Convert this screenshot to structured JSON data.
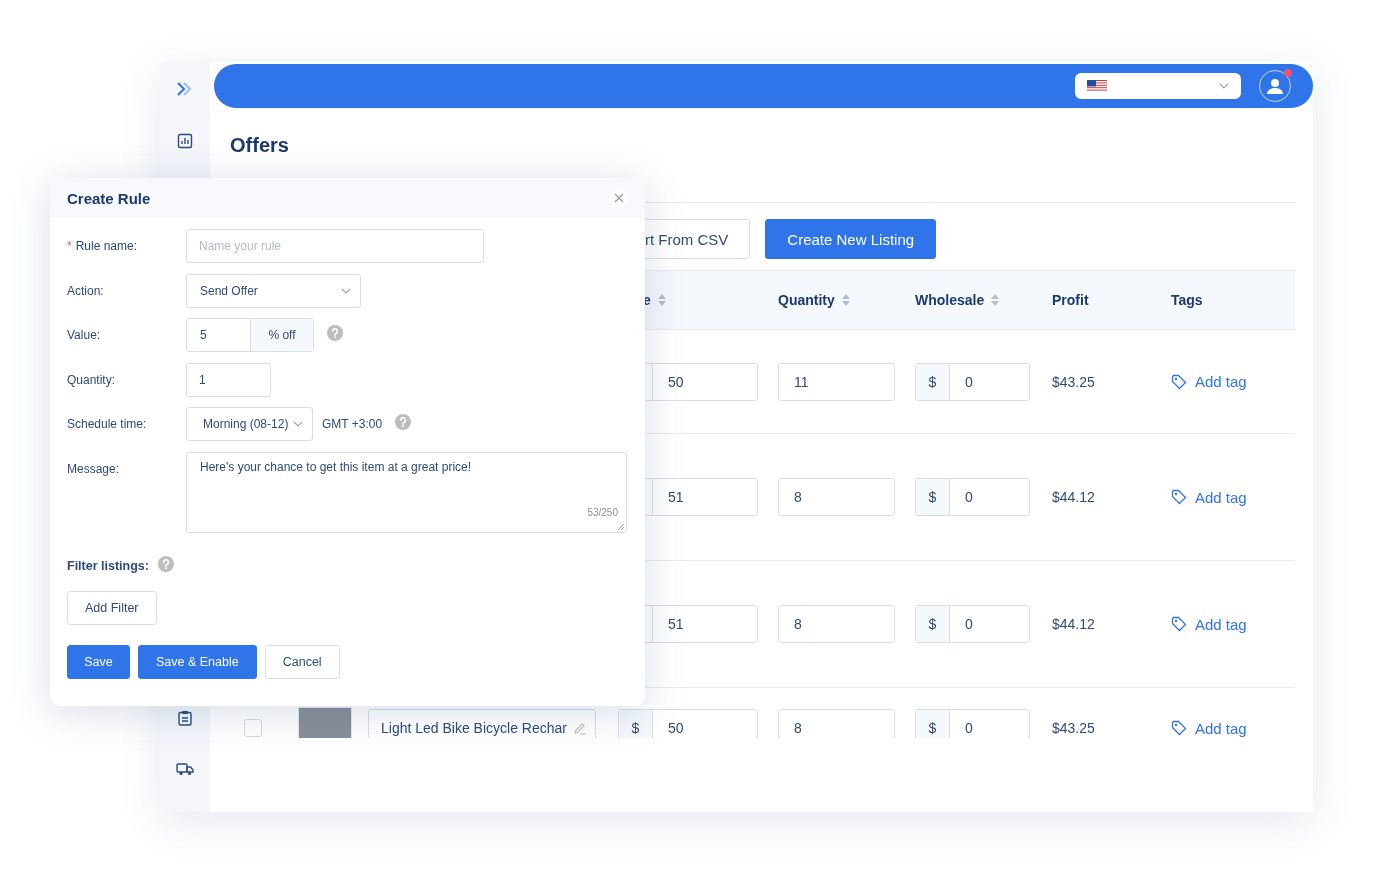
{
  "page": {
    "title": "Offers"
  },
  "toolbar": {
    "buttons": [
      {
        "label": "rt From CSV",
        "kind": "outline"
      },
      {
        "label": "Create New Listing",
        "kind": "primary"
      }
    ]
  },
  "table": {
    "columns": [
      {
        "label": "e",
        "sortable": true
      },
      {
        "label": "Quantity",
        "sortable": true
      },
      {
        "label": "Wholesale",
        "sortable": true
      },
      {
        "label": "Profit",
        "sortable": false
      },
      {
        "label": "Tags",
        "sortable": false
      }
    ],
    "rows": [
      {
        "price": "50",
        "quantity": "11",
        "wholesale_prefix": "$",
        "wholesale": "0",
        "profit": "$43.25",
        "tag_action": "Add tag"
      },
      {
        "price": "51",
        "quantity": "8",
        "wholesale_prefix": "$",
        "wholesale": "0",
        "profit": "$44.12",
        "tag_action": "Add tag"
      },
      {
        "price": "51",
        "quantity": "8",
        "wholesale_prefix": "$",
        "wholesale": "0",
        "profit": "$44.12",
        "tag_action": "Add tag"
      },
      {
        "checked": false,
        "title": "Light Led Bike Bicycle Rechar",
        "price_prefix": "$",
        "price": "50",
        "quantity": "8",
        "wholesale_prefix": "$",
        "wholesale": "0",
        "profit": "$43.25",
        "tag_action": "Add tag"
      }
    ]
  },
  "dialog": {
    "title": "Create Rule",
    "rule_name": {
      "label": "Rule name:",
      "required_mark": "*",
      "placeholder": "Name your rule"
    },
    "action": {
      "label": "Action:",
      "value": "Send Offer"
    },
    "value": {
      "label": "Value:",
      "value": "5",
      "unit": "% off"
    },
    "quantity": {
      "label": "Quantity:",
      "value": "1"
    },
    "schedule": {
      "label": "Schedule time:",
      "value": "Morning (08-12)",
      "timezone": "GMT +3:00"
    },
    "message": {
      "label": "Message:",
      "value": "Here's your chance to get this item at a great price!",
      "counter": "53/250"
    },
    "filter": {
      "label": "Filter listings:",
      "button": "Add Filter"
    },
    "buttons": [
      {
        "label": "Save",
        "kind": "primary"
      },
      {
        "label": "Save & Enable",
        "kind": "primary"
      },
      {
        "label": "Cancel",
        "kind": "outline"
      }
    ]
  }
}
